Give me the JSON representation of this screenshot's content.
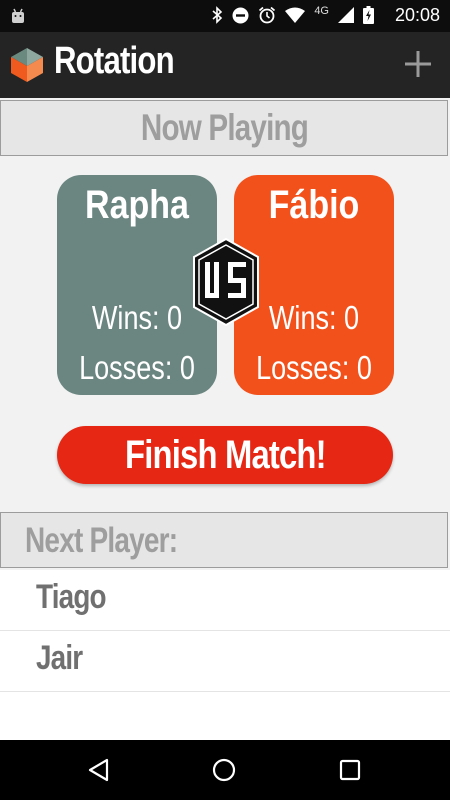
{
  "status_bar": {
    "network": "4G",
    "time": "20:08",
    "icons": [
      "android-icon",
      "bluetooth-icon",
      "do-not-disturb-icon",
      "alarm-icon",
      "wifi-icon",
      "signal-icon",
      "battery-icon"
    ]
  },
  "app_bar": {
    "title": "Rotation",
    "logo": "rotation-logo",
    "add_icon": "plus-icon"
  },
  "now_playing": {
    "header": "Now Playing",
    "players": [
      {
        "name": "Rapha",
        "wins": "Wins: 0",
        "losses": "Losses: 0",
        "color": "#6b8680"
      },
      {
        "name": "Fábio",
        "wins": "Wins: 0",
        "losses": "Losses: 0",
        "color": "#f2511c"
      }
    ],
    "vs_icon": "vs-badge-icon",
    "finish_label": "Finish Match!",
    "finish_color": "#e52714"
  },
  "next_player": {
    "header": "Next Player:",
    "queue": [
      "Tiago",
      "Jair"
    ]
  },
  "nav_bar": {
    "icons": [
      "back-icon",
      "home-icon",
      "recents-icon"
    ]
  }
}
